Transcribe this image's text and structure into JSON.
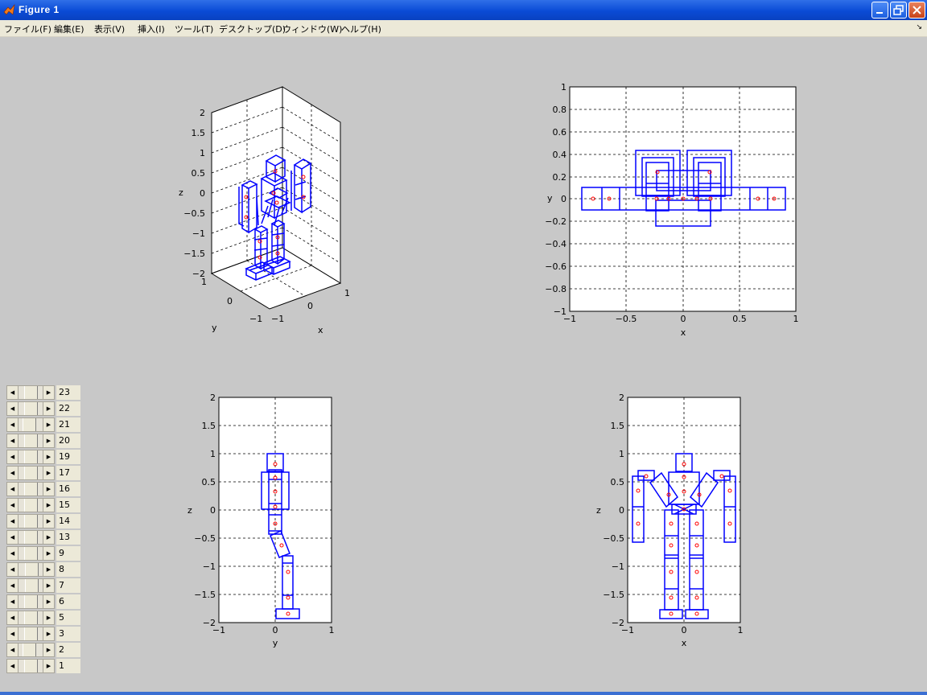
{
  "window": {
    "title": "Figure 1",
    "title_icon": "matlab-logo-icon",
    "controls": [
      "minimize-icon",
      "restore-icon",
      "close-icon"
    ]
  },
  "menubar": {
    "items": [
      {
        "label": "ファイル(F)"
      },
      {
        "label": "編集(E)"
      },
      {
        "label": "表示(V)"
      },
      {
        "label": "挿入(I)"
      },
      {
        "label": "ツール(T)"
      },
      {
        "label": "デスクトップ(D)"
      },
      {
        "label": "ウィンドウ(W)"
      },
      {
        "label": "ヘルプ(H)"
      }
    ],
    "overflow_icon": "chevron-icon"
  },
  "colors": {
    "robot": "#0000ff",
    "joints": "#ff0000",
    "grid": "#000000",
    "background": "#c8c8c8",
    "axes_bg": "#ffffff"
  },
  "sliders": {
    "labels": [
      "23",
      "22",
      "21",
      "20",
      "19",
      "17",
      "16",
      "15",
      "14",
      "13",
      "9",
      "8",
      "7",
      "6",
      "5",
      "3",
      "2",
      "1"
    ],
    "values": [
      0.5,
      0.5,
      0.4,
      0.5,
      0.5,
      0.5,
      0.5,
      0.5,
      0.5,
      0.5,
      0.5,
      0.6,
      0.6,
      0.5,
      0.5,
      0.5,
      0.4,
      0.5
    ]
  },
  "chart_data": [
    {
      "type": "other",
      "view": "3d",
      "xlabel": "x",
      "ylabel": "y",
      "zlabel": "z",
      "xlim": [
        -1,
        1
      ],
      "ylim": [
        -1,
        1
      ],
      "zlim": [
        -2,
        2
      ],
      "xticks": [
        "−1",
        "0",
        "1"
      ],
      "yticks": [
        "−1",
        "0",
        "1"
      ],
      "zticks": [
        "2",
        "1.5",
        "1",
        "0.5",
        "0",
        "−0.5",
        "−1",
        "−1.5",
        "−2"
      ],
      "grid": true
    },
    {
      "type": "other",
      "view": "top",
      "xlabel": "x",
      "ylabel": "y",
      "xlim": [
        -1,
        1
      ],
      "ylim": [
        -1,
        1
      ],
      "xticks": [
        "−1",
        "−0.5",
        "0",
        "0.5",
        "1"
      ],
      "yticks": [
        "1",
        "0.8",
        "0.6",
        "0.4",
        "0.2",
        "0",
        "−0.2",
        "−0.4",
        "−0.6",
        "−0.8",
        "−1"
      ],
      "grid": true
    },
    {
      "type": "other",
      "view": "side",
      "xlabel": "y",
      "ylabel": "z",
      "xlim": [
        -1,
        1
      ],
      "ylim": [
        -2,
        2
      ],
      "xticks": [
        "−1",
        "0",
        "1"
      ],
      "yticks": [
        "2",
        "1.5",
        "1",
        "0.5",
        "0",
        "−0.5",
        "−1",
        "−1.5",
        "−2"
      ],
      "grid": true
    },
    {
      "type": "other",
      "view": "front",
      "xlabel": "x",
      "ylabel": "z",
      "xlim": [
        -1,
        1
      ],
      "ylim": [
        -2,
        2
      ],
      "xticks": [
        "−1",
        "0",
        "1"
      ],
      "yticks": [
        "2",
        "1.5",
        "1",
        "0.5",
        "0",
        "−0.5",
        "−1",
        "−1.5",
        "−2"
      ],
      "grid": true
    }
  ]
}
